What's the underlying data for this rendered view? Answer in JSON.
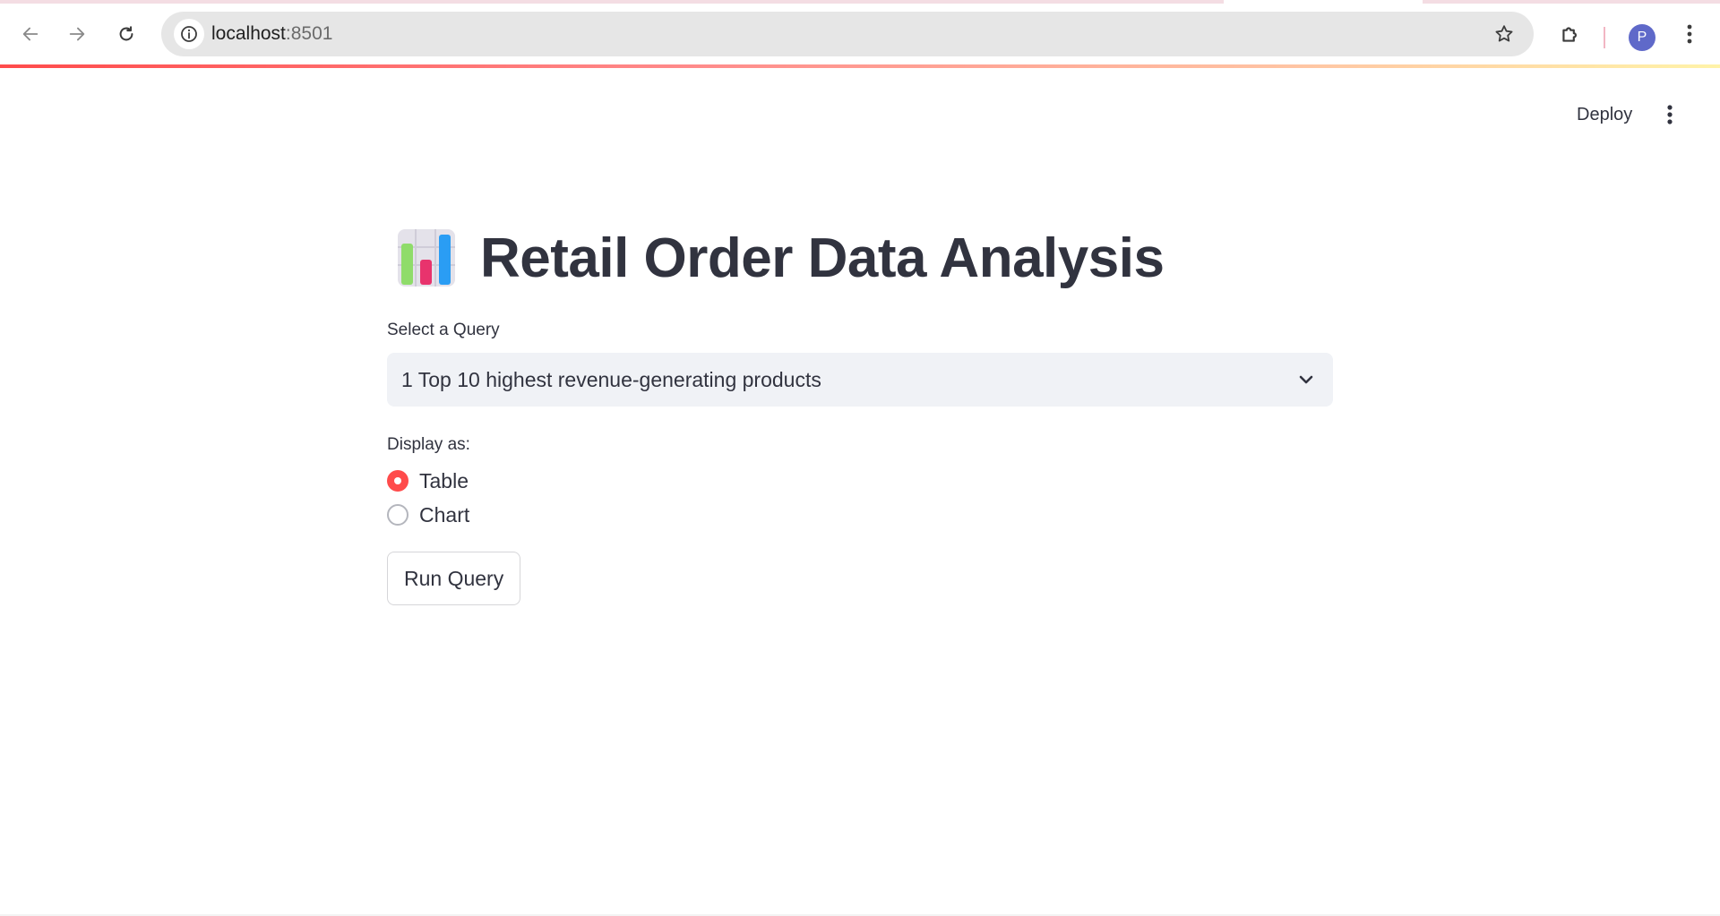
{
  "browser": {
    "url_host": "localhost",
    "url_port": ":8501",
    "profile_initial": "P"
  },
  "header": {
    "deploy_label": "Deploy"
  },
  "main": {
    "title": "Retail Order Data Analysis",
    "title_icon": "bar-chart-emoji",
    "select": {
      "label": "Select a Query",
      "value": "1 Top 10 highest revenue-generating products"
    },
    "display": {
      "label": "Display as:",
      "options": [
        "Table",
        "Chart"
      ],
      "selected": "Table"
    },
    "run_button_label": "Run Query"
  },
  "colors": {
    "accent": "#ff4b4b",
    "text": "#31333f",
    "select_bg": "#f0f2f6",
    "avatar": "#5f69c9"
  }
}
